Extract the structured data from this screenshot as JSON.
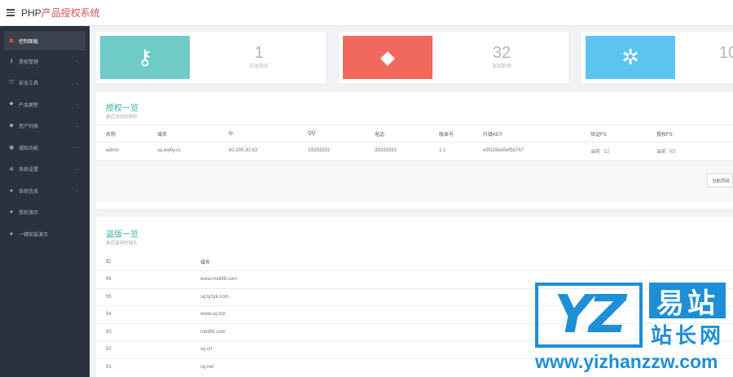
{
  "header": {
    "title_prefix": "PHP",
    "title_suffix": "产品授权系统"
  },
  "sidebar": {
    "items": [
      {
        "label": "控制面板",
        "icon": "dashboard-icon",
        "glyph": "☗",
        "active": true
      },
      {
        "label": "授权管理",
        "icon": "key-icon",
        "glyph": "⚷",
        "arrow": "←"
      },
      {
        "label": "安全工具",
        "icon": "shield-icon",
        "glyph": "⛉",
        "arrow": "←"
      },
      {
        "label": "产品更新",
        "icon": "tags-icon",
        "glyph": "⬥",
        "arrow": "←"
      },
      {
        "label": "用户列表",
        "icon": "users-icon",
        "glyph": "☻",
        "arrow": "←"
      },
      {
        "label": "通知功能",
        "icon": "bell-icon",
        "glyph": "◉",
        "arrow": "←"
      },
      {
        "label": "系统设置",
        "icon": "gears-icon",
        "glyph": "✲",
        "arrow": "←"
      },
      {
        "label": "系统信息",
        "icon": "info-icon",
        "glyph": "●",
        "arrow": "←"
      },
      {
        "label": "授权演示",
        "icon": "eye-icon",
        "glyph": "●"
      },
      {
        "label": "一键安装演示",
        "icon": "play-icon",
        "glyph": "●"
      }
    ]
  },
  "stats": [
    {
      "value": "1",
      "label": "正版授权",
      "icon": "key-icon",
      "glyph": "⚷",
      "color": "#6ecbc8"
    },
    {
      "value": "32",
      "label": "盗版数据",
      "icon": "tags-icon",
      "glyph": "⬥",
      "color": "#f1695c"
    },
    {
      "value": "10",
      "label": "",
      "icon": "gears-icon",
      "glyph": "✲",
      "color": "#5bc4f1"
    }
  ],
  "licenses": {
    "title": "授权一览",
    "subtitle": "最近添加的授权",
    "columns": [
      "名称",
      "域名",
      "ip",
      "QQ",
      "电话",
      "版本号",
      "升级KEY",
      "验证FS",
      "授权FS"
    ],
    "rows": [
      [
        "admin",
        "sq.weby.cc",
        "60.205.30.83",
        "33333333",
        "33333333",
        "1.1",
        "e9f329ee5ef5b767",
        "当前（1）",
        "当前（0）"
      ]
    ],
    "page_button": "当前页码"
  },
  "piracy": {
    "title": "盗版一览",
    "subtitle": "最近盗用的域名",
    "columns": [
      "ID",
      "域名"
    ],
    "rows": [
      [
        "96",
        "www.meli88.com"
      ],
      [
        "95",
        "sq.tyzyk.com"
      ],
      [
        "94",
        "www.sq.top"
      ],
      [
        "93",
        "meli88.com"
      ],
      [
        "92",
        "sq.cn"
      ],
      [
        "91",
        "sq.net"
      ]
    ]
  },
  "watermark": {
    "logo": "YZ",
    "cn_top": "易站",
    "cn_bottom": "站长网",
    "url": "www.yizhanzzw.com"
  }
}
